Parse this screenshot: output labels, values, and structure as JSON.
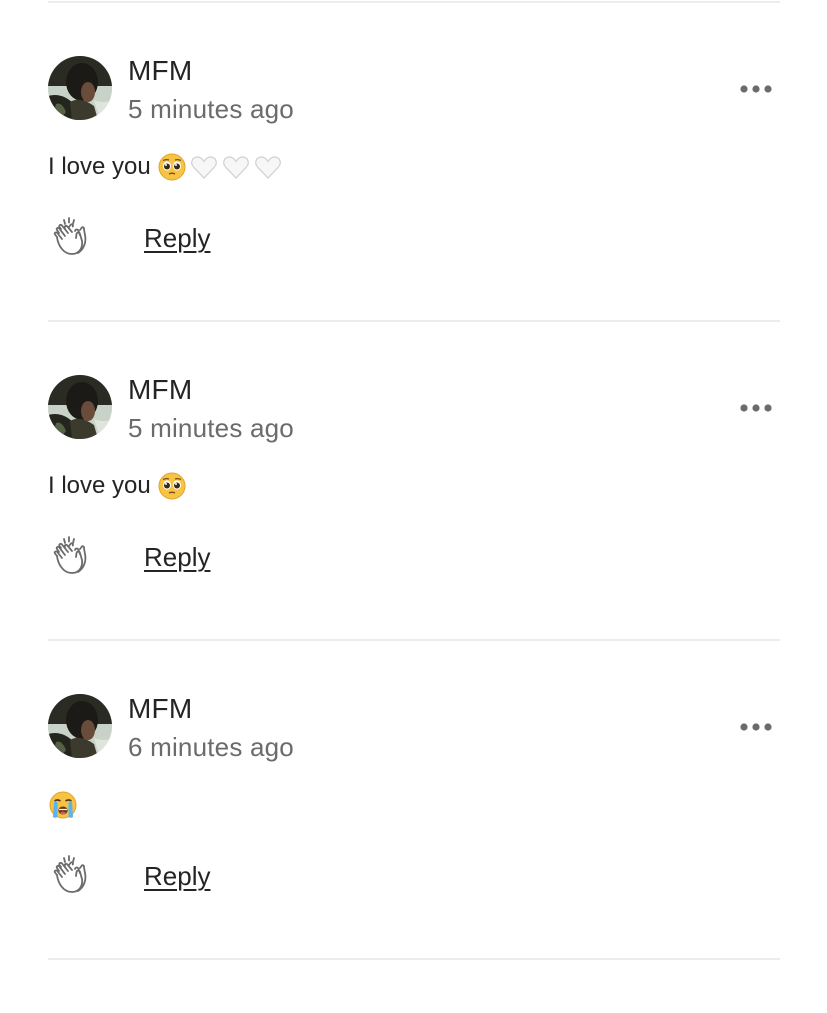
{
  "comments": [
    {
      "author": "MFM",
      "time": "5 minutes ago",
      "text": "I love you",
      "emojis": [
        "pleading-face",
        "white-heart",
        "white-heart",
        "white-heart"
      ],
      "reply_label": "Reply"
    },
    {
      "author": "MFM",
      "time": "5 minutes ago",
      "text": "I love you",
      "emojis": [
        "pleading-face"
      ],
      "reply_label": "Reply"
    },
    {
      "author": "MFM",
      "time": "6 minutes ago",
      "text": "",
      "emojis": [
        "loudly-crying-face"
      ],
      "reply_label": "Reply"
    }
  ],
  "icons": {
    "clap": "clap-icon",
    "more": "more-options-icon"
  },
  "colors": {
    "primary_text": "#242424",
    "secondary_text": "#6b6b6b",
    "divider": "#ececec"
  }
}
